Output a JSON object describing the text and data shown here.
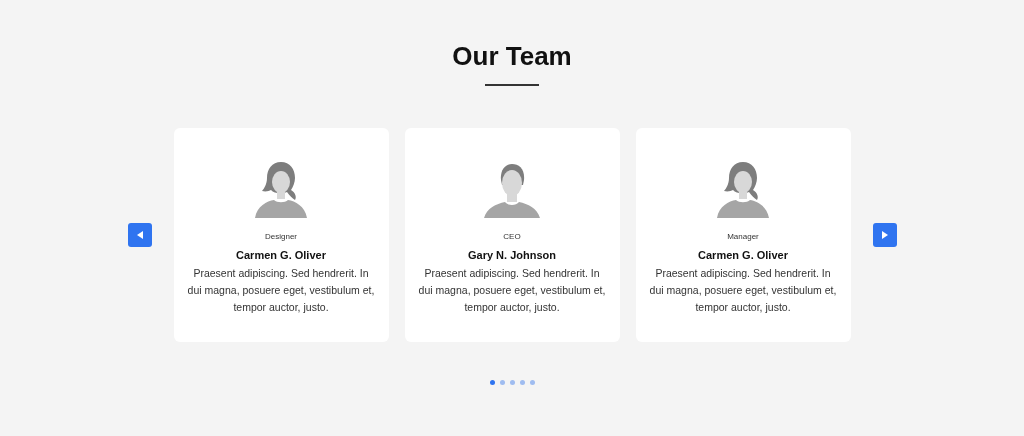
{
  "heading": "Our Team",
  "members": [
    {
      "kind": "female",
      "role": "Designer",
      "name": "Carmen G. Oliver",
      "bio": "Praesent adipiscing. Sed hendrerit. In dui magna, posuere eget, vestibulum et, tempor auctor, justo."
    },
    {
      "kind": "male",
      "role": "CEO",
      "name": "Gary N. Johnson",
      "bio": "Praesent adipiscing. Sed hendrerit. In dui magna, posuere eget, vestibulum et, tempor auctor, justo."
    },
    {
      "kind": "female",
      "role": "Manager",
      "name": "Carmen G. Oliver",
      "bio": "Praesent adipiscing. Sed hendrerit. In dui magna, posuere eget, vestibulum et, tempor auctor, justo."
    }
  ],
  "dots": [
    {
      "selected": true
    },
    {
      "selected": false
    },
    {
      "selected": false
    },
    {
      "selected": false
    },
    {
      "selected": false
    }
  ]
}
